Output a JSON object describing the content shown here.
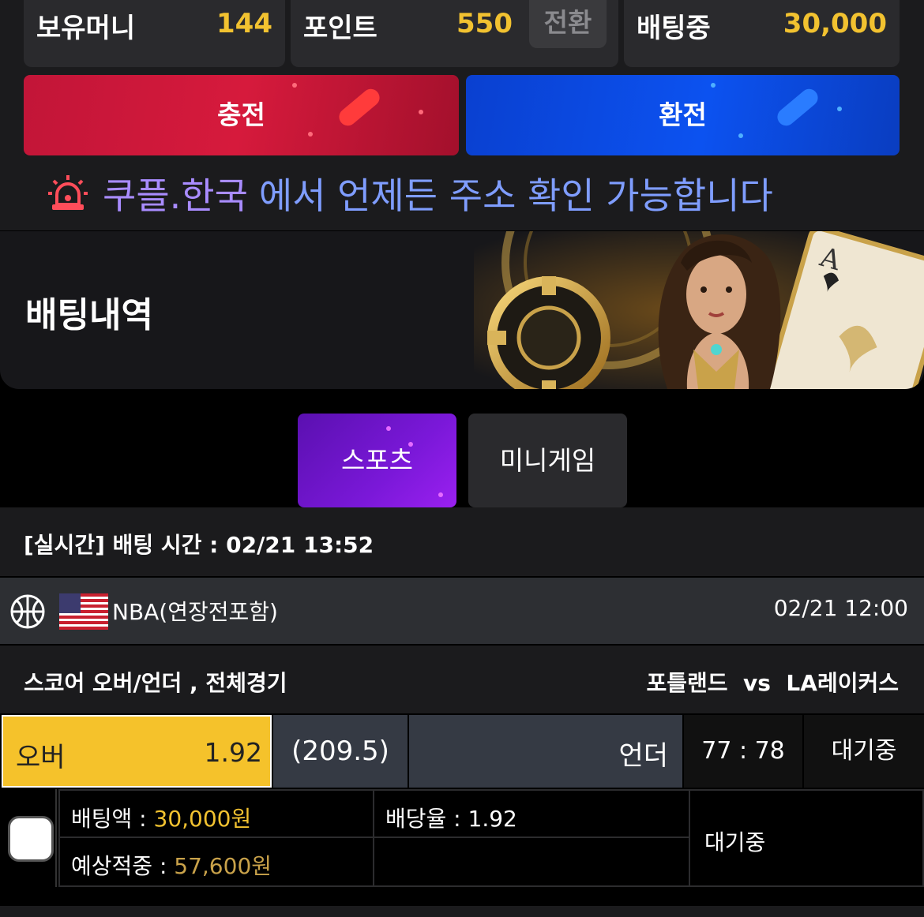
{
  "balance": {
    "money_label": "보유머니",
    "money_value": "144",
    "point_label": "포인트",
    "point_value": "550",
    "convert_label": "전환",
    "betting_label": "배팅중",
    "betting_value": "30,000"
  },
  "actions": {
    "charge_label": "충전",
    "exchange_label": "환전"
  },
  "notice": {
    "icon": "alarm-light-icon",
    "domain": "쿠플.한국",
    "text": "에서 언제든 주소 확인 가능합니다"
  },
  "banner": {
    "title": "배팅내역"
  },
  "tabs": [
    {
      "label": "스포츠",
      "active": true
    },
    {
      "label": "미니게임",
      "active": false
    }
  ],
  "bet": {
    "time_text": "[실시간] 배팅 시간 : 02/21 13:52",
    "sport_icon": "basketball-icon",
    "flag_icon": "us-flag-icon",
    "league": "NBA(연장전포함)",
    "game_date": "02/21 12:00",
    "market": "스코어 오버/언더 , 전체경기",
    "matchup": "포틀랜드  vs  LA레이커스",
    "over_label": "오버",
    "over_odds": "1.92",
    "line": "(209.5)",
    "under_label": "언더",
    "score": "77 : 78",
    "status": "대기중",
    "amount_label": "배팅액 : ",
    "amount_value": "30,000원",
    "rate_label": "배당율 : 1.92",
    "expect_label": "예상적중 : ",
    "expect_value": "57,600원",
    "detail_status": "대기중"
  },
  "colors": {
    "gold": "#f2c230",
    "charge": "#c21538",
    "exchange": "#0c52f0",
    "sports_tab": "#7a18d8",
    "over_highlight": "#f5c22b"
  }
}
